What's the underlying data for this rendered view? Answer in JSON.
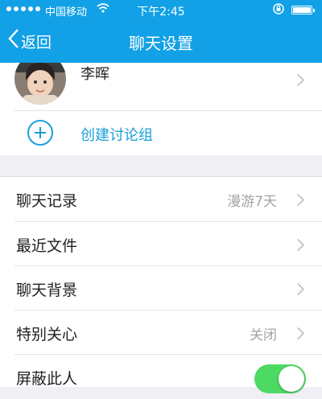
{
  "status_bar": {
    "carrier": "中国移动",
    "time": "下午2:45",
    "wifi_icon": "wifi-icon",
    "lock_icon": "orientation-lock-icon",
    "battery_icon": "battery-icon"
  },
  "nav": {
    "back_label": "返回",
    "back_icon": "chevron-left-icon",
    "title": "聊天设置"
  },
  "contact": {
    "name": "李晖"
  },
  "group": {
    "label": "创建讨论组",
    "icon": "plus-circle-icon"
  },
  "settings": [
    {
      "label": "聊天记录",
      "value": "漫游7天",
      "chevron": true
    },
    {
      "label": "最近文件",
      "value": "",
      "chevron": true
    },
    {
      "label": "聊天背景",
      "value": "",
      "chevron": true
    },
    {
      "label": "特别关心",
      "value": "关闭",
      "chevron": true
    },
    {
      "label": "屏蔽此人",
      "value": "",
      "chevron": false,
      "toggle_on": true
    }
  ],
  "colors": {
    "accent": "#12a1e6",
    "link": "#1b9fd8",
    "toggle_on": "#4cd964",
    "background": "#efeff4"
  }
}
